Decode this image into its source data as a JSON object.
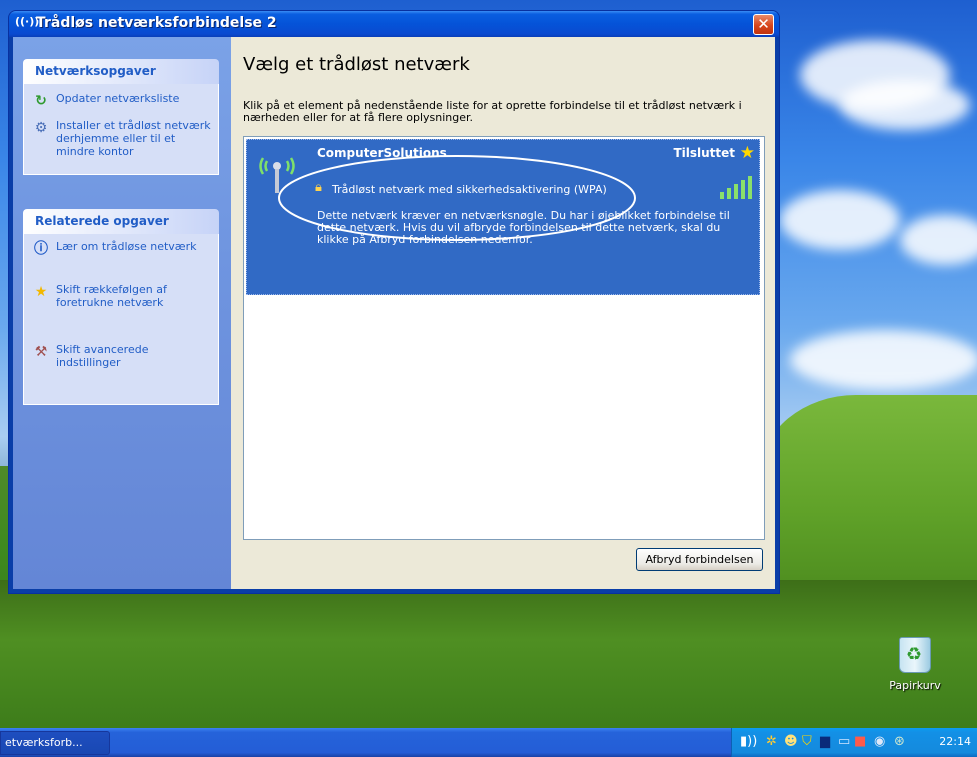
{
  "window": {
    "title": "Trådløs netværksforbindelse 2",
    "title_icon": "((·))",
    "close_label": "✕"
  },
  "taskpane": {
    "groups": [
      {
        "header": "Netværksopgaver",
        "items": [
          {
            "label": "Opdater netværksliste",
            "icon": "refresh-icon"
          },
          {
            "label": "Installer et trådløst netværk derhjemme eller til et mindre kontor",
            "icon": "setup-wizard-icon"
          }
        ]
      },
      {
        "header": "Relaterede opgaver",
        "items": [
          {
            "label": "Lær om trådløse netværk",
            "icon": "info-icon"
          },
          {
            "label": "Skift rækkefølgen af foretrukne netværk",
            "icon": "star-icon"
          },
          {
            "label": "Skift avancerede indstillinger",
            "icon": "settings-icon"
          }
        ]
      }
    ]
  },
  "main": {
    "title": "Vælg et trådløst netværk",
    "description": "Klik på et element på nedenstående liste for at oprette forbindelse til et trådløst netværk i nærheden eller for at få flere oplysninger.",
    "network": {
      "name": "ComputerSolutions",
      "status": "Tilsluttet",
      "security": "Trådløst netværk med sikkerhedsaktivering (WPA)",
      "description": "Dette netværk kræver en netværksnøgle. Du har i øjeblikket forbindelse til dette netværk. Hvis du vil afbryde forbindelsen til dette netværk, skal du klikke på Afbryd forbindelsen nedenfor.",
      "signal_bars": 5
    },
    "disconnect_button": "Afbryd forbindelsen"
  },
  "desktop": {
    "recycle_bin_label": "Papirkurv"
  },
  "taskbar": {
    "task_button_label": "etværksforb...",
    "clock": "22:14"
  },
  "colors": {
    "titlebar": "#0553d8",
    "selection": "#316ac5",
    "taskpane_link": "#215dc6",
    "taskbar": "#245dd6",
    "tray": "#148add"
  }
}
